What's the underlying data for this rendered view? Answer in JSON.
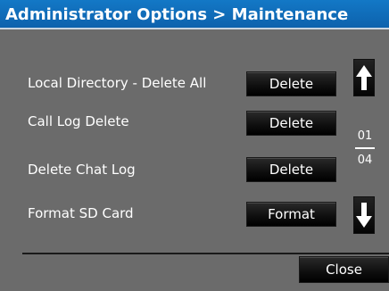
{
  "title": "Administrator Options > Maintenance",
  "rows": [
    {
      "label": "Local Directory - Delete All",
      "button": "Delete"
    },
    {
      "label": "Call Log Delete",
      "button": "Delete"
    },
    {
      "label": "Delete Chat Log",
      "button": "Delete"
    },
    {
      "label": "Format SD Card",
      "button": "Format"
    }
  ],
  "pager": {
    "current": "01",
    "total": "04",
    "up_icon": "arrow-up-icon",
    "down_icon": "arrow-down-icon"
  },
  "footer": {
    "close_label": "Close"
  },
  "colors": {
    "titlebar": "#0d62ad",
    "background": "#6b6b6b",
    "button": "#000000",
    "text": "#ffffff"
  }
}
